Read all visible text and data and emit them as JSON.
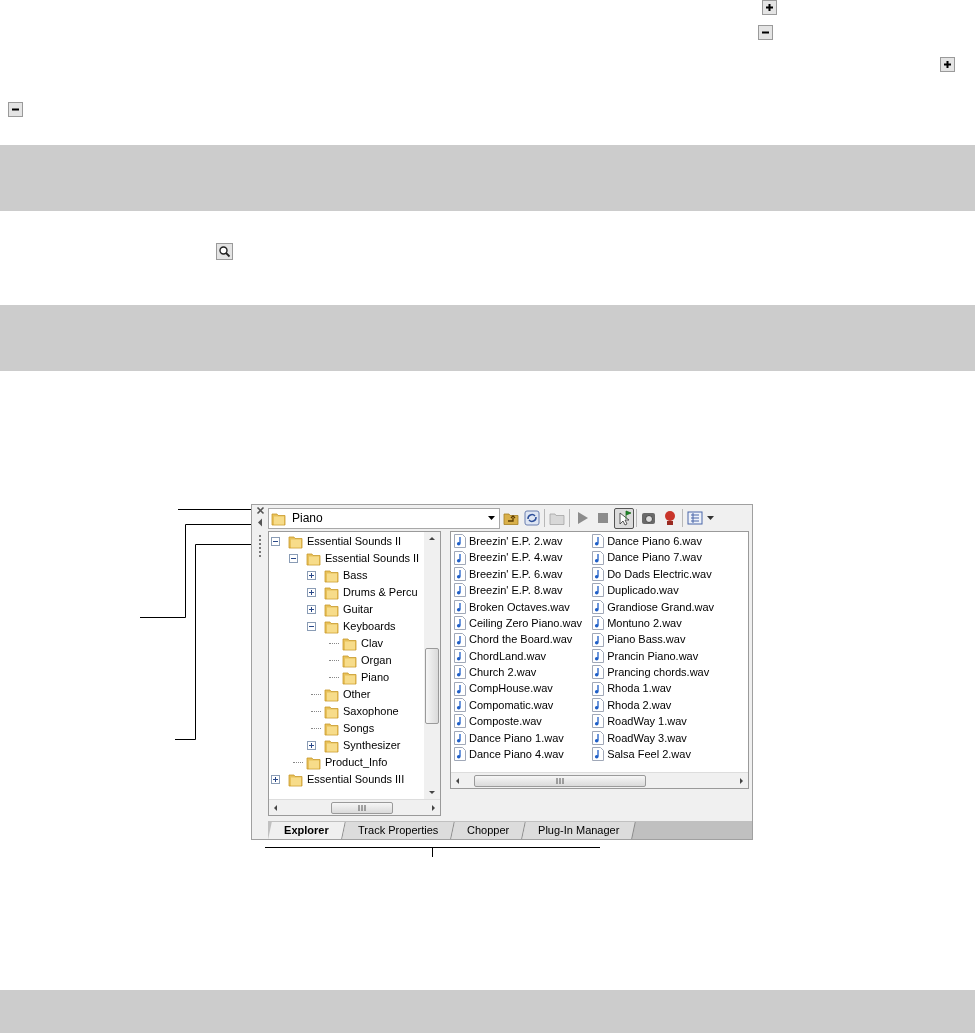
{
  "explorer": {
    "location": "Piano",
    "toolbar": [
      {
        "kind": "up-folder",
        "pressed": false
      },
      {
        "kind": "refresh",
        "pressed": false
      },
      {
        "kind": "new-folder",
        "pressed": false
      },
      {
        "kind": "play",
        "pressed": false
      },
      {
        "kind": "stop",
        "pressed": false
      },
      {
        "kind": "select",
        "pressed": true
      },
      {
        "kind": "media",
        "pressed": false
      },
      {
        "kind": "record",
        "pressed": false
      },
      {
        "kind": "view",
        "pressed": false
      }
    ],
    "tree": [
      {
        "label": "Essential Sounds II",
        "expanded": true,
        "children": [
          {
            "label": "Essential Sounds II",
            "expanded": true,
            "children": [
              {
                "label": "Bass",
                "expanded": false
              },
              {
                "label": "Drums & Percu",
                "expanded": false
              },
              {
                "label": "Guitar",
                "expanded": false
              },
              {
                "label": "Keyboards",
                "expanded": true,
                "children": [
                  {
                    "label": "Clav"
                  },
                  {
                    "label": "Organ"
                  },
                  {
                    "label": "Piano"
                  }
                ]
              },
              {
                "label": "Other"
              },
              {
                "label": "Saxophone"
              },
              {
                "label": "Songs"
              },
              {
                "label": "Synthesizer",
                "expanded": false
              }
            ]
          },
          {
            "label": "Product_Info"
          }
        ]
      },
      {
        "label": "Essential Sounds III",
        "expanded": false
      }
    ],
    "files": [
      "Breezin' E.P. 2.wav",
      "Breezin' E.P. 4.wav",
      "Breezin' E.P. 6.wav",
      "Breezin' E.P. 8.wav",
      "Broken Octaves.wav",
      "Ceiling Zero Piano.wav",
      "Chord the Board.wav",
      "ChordLand.wav",
      "Church 2.wav",
      "CompHouse.wav",
      "Compomatic.wav",
      "Composte.wav",
      "Dance Piano 1.wav",
      "Dance Piano 4.wav",
      "Dance Piano 6.wav",
      "Dance Piano 7.wav",
      "Do Dads Electric.wav",
      "Duplicado.wav",
      "Grandiose Grand.wav",
      "Montuno 2.wav",
      "Piano Bass.wav",
      "Prancin Piano.wav",
      "Prancing chords.wav",
      "Rhoda 1.wav",
      "Rhoda 2.wav",
      "RoadWay 1.wav",
      "RoadWay 3.wav",
      "Salsa Feel 2.wav"
    ],
    "tabs": [
      {
        "label": "Explorer",
        "selected": true
      },
      {
        "label": "Track Properties",
        "selected": false
      },
      {
        "label": "Chopper",
        "selected": false
      },
      {
        "label": "Plug-In Manager",
        "selected": false
      }
    ]
  }
}
